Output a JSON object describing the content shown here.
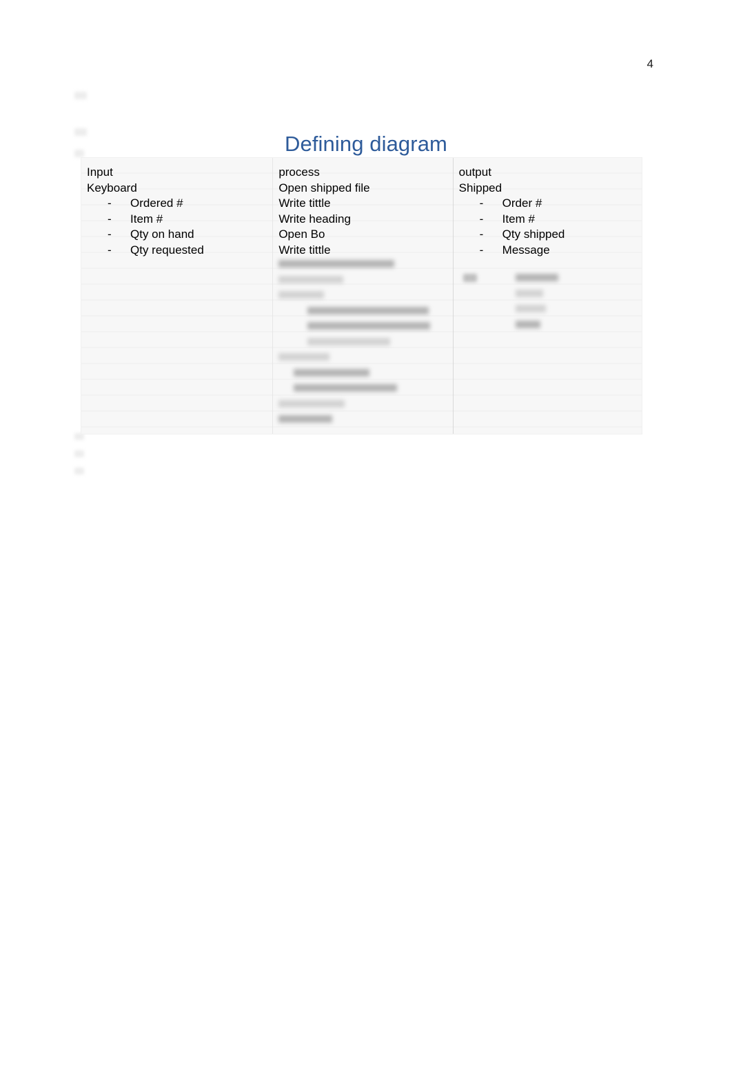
{
  "document": {
    "page_number": "4",
    "title": "Defining diagram",
    "title_color": "#2E5B9A"
  },
  "table": {
    "columns": [
      {
        "header": "Input",
        "subject": "Keyboard",
        "bullet_marker": "-",
        "items": [
          "Ordered #",
          "Item #",
          "Qty on hand",
          "Qty requested"
        ]
      },
      {
        "header": "process",
        "subject": "Open shipped file",
        "bullet_marker": "-",
        "lines": [
          "Write tittle",
          "Write heading",
          "Open Bo",
          "Write tittle"
        ],
        "items": []
      },
      {
        "header": "output",
        "subject": "Shipped",
        "bullet_marker": "-",
        "items": [
          "Order #",
          "Item #",
          "Qty shipped",
          "Message"
        ]
      }
    ]
  },
  "redacted": {
    "note": "blurred illegible text",
    "process_block_widths": [
      168,
      94,
      66,
      176,
      178,
      120,
      74,
      110,
      150,
      96,
      78
    ],
    "output_block_widths": [
      62,
      40,
      44,
      36
    ]
  }
}
